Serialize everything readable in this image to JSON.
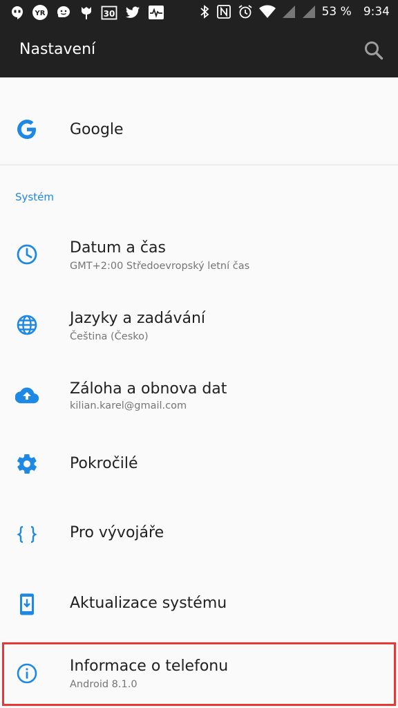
{
  "status_bar": {
    "battery": "53 %",
    "time": "9:34",
    "calendar_day": "30",
    "left_icons": [
      "hangouts-icon",
      "yr-icon",
      "waze-icon",
      "tulip-icon",
      "calendar-icon",
      "twitter-icon",
      "pulse-icon"
    ],
    "right_icons": [
      "bluetooth-icon",
      "nfc-icon",
      "alarm-icon",
      "wifi-icon",
      "signal-icon",
      "signal-icon"
    ]
  },
  "app_bar": {
    "title": "Nastavení"
  },
  "google_item": {
    "title": "Google"
  },
  "section_system": {
    "label": "Systém"
  },
  "items": [
    {
      "title": "Datum a čas",
      "subtitle": "GMT+2:00 Středoevropský letní čas",
      "icon": "clock-icon"
    },
    {
      "title": "Jazyky a zadávání",
      "subtitle": "Čeština (Česko)",
      "icon": "globe-icon"
    },
    {
      "title": "Záloha a obnova dat",
      "subtitle": "kilian.karel@gmail.com",
      "icon": "cloud-upload-icon"
    },
    {
      "title": "Pokročilé",
      "subtitle": "",
      "icon": "gear-icon"
    },
    {
      "title": "Pro vývojáře",
      "subtitle": "",
      "icon": "braces-icon"
    },
    {
      "title": "Aktualizace systému",
      "subtitle": "",
      "icon": "system-update-icon"
    },
    {
      "title": "Informace o telefonu",
      "subtitle": "Android 8.1.0",
      "icon": "info-icon"
    }
  ],
  "colors": {
    "accent": "#1e88e5",
    "bar": "#212121",
    "highlight": "#e53935"
  }
}
